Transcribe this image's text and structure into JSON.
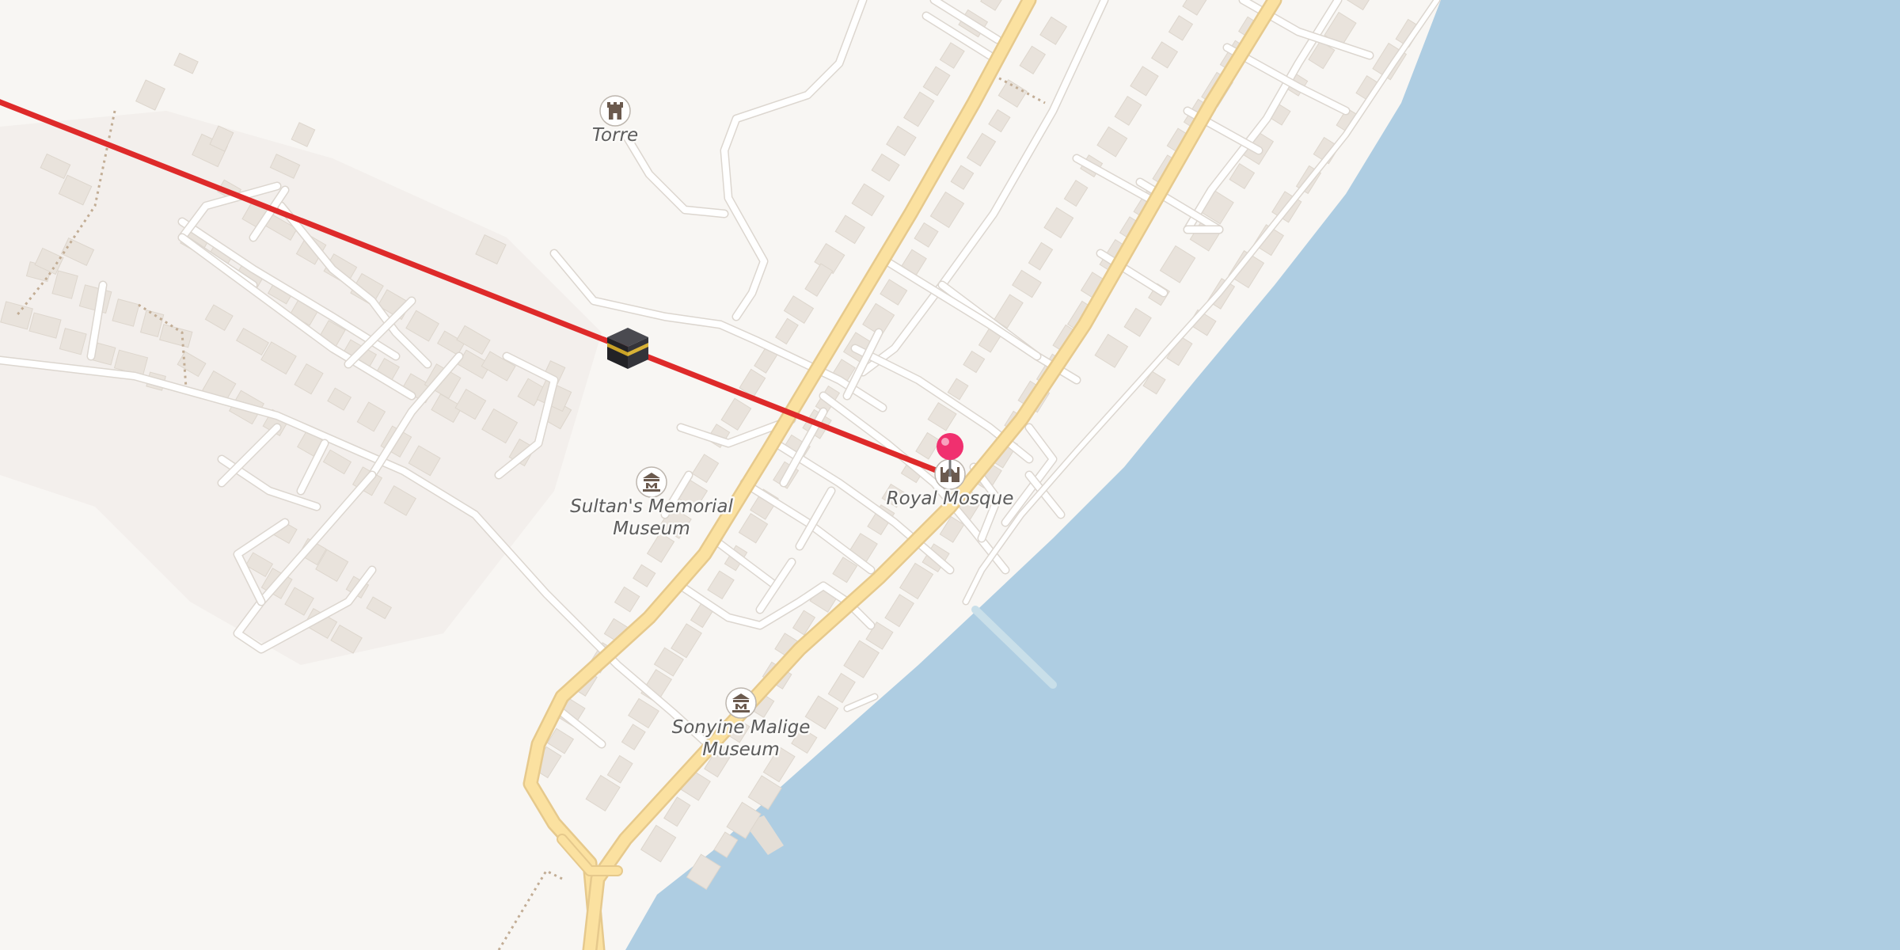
{
  "map": {
    "colors": {
      "land": "#f8f6f3",
      "landuse": "#f1eeea",
      "water": "#aecde2",
      "building": "#e9e3dc",
      "building_edge": "#ddd6cd",
      "minor_road_casing": "#dcd6cf",
      "minor_road": "#ffffff",
      "main_road_casing": "#e6c98c",
      "main_road": "#fbe1a0",
      "path": "#c2ad95",
      "qibla_line": "#de2a2a",
      "pin": "#f0306f"
    },
    "pois": [
      {
        "name": "Torre",
        "icon": "tower-icon"
      },
      {
        "name_lines": [
          "Sultan's Memorial",
          "Museum"
        ],
        "icon": "museum-icon"
      },
      {
        "name_lines": [
          "Sonyine Malige",
          "Museum"
        ],
        "icon": "museum-icon"
      },
      {
        "name": "Royal Mosque",
        "icon": "mosque-icon"
      }
    ],
    "markers": [
      {
        "icon": "kaaba-icon"
      },
      {
        "icon": "pin-icon"
      }
    ]
  }
}
